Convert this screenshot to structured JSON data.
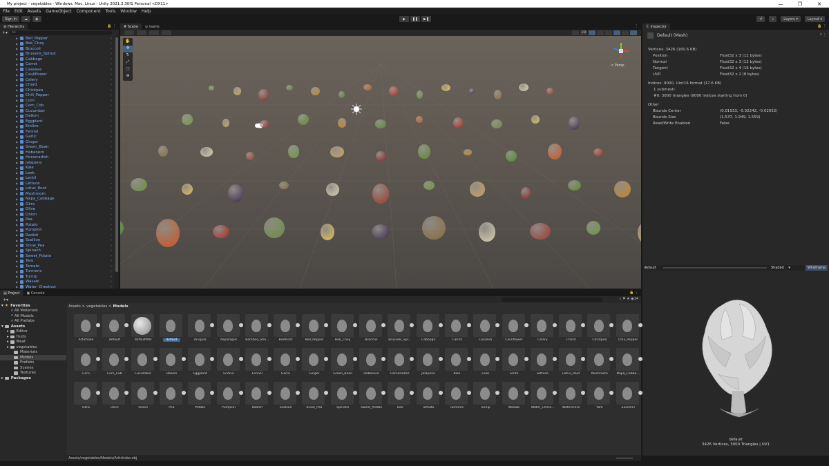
{
  "window": {
    "title": "My project - vegetables - Windows, Mac, Linux - Unity 2021.3.30f1 Personal <DX11>",
    "minimize": "—",
    "restore": "❐",
    "close": "✕"
  },
  "menu": [
    "File",
    "Edit",
    "Assets",
    "GameObject",
    "Component",
    "Tools",
    "Window",
    "Help"
  ],
  "toolbar": {
    "sign_in": "Sign In",
    "layers": "Layers",
    "layout": "Layout"
  },
  "hierarchy": {
    "tab": "Hierarchy",
    "search_placeholder": "All",
    "items": [
      "Bell_Pepper",
      "Bok_Choy",
      "Broccoli",
      "Brussels_Sprout",
      "Cabbage",
      "Carrot",
      "Cassava",
      "Cauliflower",
      "Celery",
      "Chard",
      "Chickpea",
      "Chili_Pepper",
      "Corn",
      "Corn_Cob",
      "Cucumber",
      "Daikon",
      "Eggplant",
      "Endive",
      "Fennel",
      "Garlic",
      "Ginger",
      "Green_Bean",
      "Habanero",
      "Horseradish",
      "Jalapeno",
      "Kale",
      "Leek",
      "Lentil",
      "Lettuce",
      "Lotus_Root",
      "Mushroom",
      "Napa_Cabbage",
      "Okra",
      "Olive",
      "Onion",
      "Pea",
      "Potato",
      "Pumpkin",
      "Radish",
      "Scallion",
      "Snow_Pea",
      "Spinach",
      "Sweet_Potato",
      "Taro",
      "Tomato",
      "Turmeric",
      "Turnip",
      "Wasabi",
      "Water_Chestnut"
    ]
  },
  "scene": {
    "tab_scene": "Scene",
    "tab_game": "Game",
    "mode_2d": "2D",
    "persp": "< Persp"
  },
  "inspector": {
    "tab": "Inspector",
    "title": "Default (Mesh)",
    "vertices": "Vertices: 3426 (160.6 KB)",
    "attributes": [
      {
        "name": "Position",
        "value": "Float32 x 3 (12 bytes)"
      },
      {
        "name": "Normal",
        "value": "Float32 x 3 (12 bytes)"
      },
      {
        "name": "Tangent",
        "value": "Float32 x 4 (16 bytes)"
      },
      {
        "name": "UV0",
        "value": "Float32 x 2 (8 bytes)"
      }
    ],
    "indices": "Indices: 9000, Uint16 format (17.6 KB)",
    "submesh": "1 submesh:",
    "submesh0": "#0: 3000 triangles (9000 indices starting from 0)",
    "other_header": "Other",
    "other": [
      {
        "name": "Bounds Center",
        "value": "(0.01933, -0.02242, -0.02052)"
      },
      {
        "name": "Bounds Size",
        "value": "(1.537, 1.949, 1.559)"
      },
      {
        "name": "Read/Write Enabled",
        "value": "False"
      }
    ]
  },
  "preview": {
    "name": "default",
    "shaded": "Shaded",
    "wireframe": "Wireframe",
    "caption_name": "default",
    "caption_stats": "3426 Vertices, 3000 Triangles | UV1"
  },
  "project": {
    "tab_project": "Project",
    "tab_console": "Console",
    "count": "14",
    "breadcrumb": {
      "a": "Assets",
      "b": "vegetables",
      "c": "Models"
    },
    "tree": {
      "favorites": "Favorites",
      "fav_items": [
        "All Materials",
        "All Models",
        "All Prefabs"
      ],
      "assets": "Assets",
      "asset_items": [
        "Editor",
        "fruits",
        "Meat",
        "vegetables"
      ],
      "veg_items": [
        "Materials",
        "Models",
        "Prefabs",
        "Scenes",
        "Textures"
      ],
      "packages": "Packages"
    },
    "assets": [
      "Artichoke",
      "default",
      "defaultMat",
      "default",
      "Arugula",
      "Asparagus",
      "Bamboo_Sho...",
      "Beetroot",
      "Bell_Pepper",
      "Bok_Choy",
      "Broccoli",
      "Brussels_Spr...",
      "Cabbage",
      "Carrot",
      "Cassava",
      "Cauliflower",
      "Celery",
      "Chard",
      "Chickpea",
      "Chili_Pepper",
      "Corn",
      "Corn_Cob",
      "Cucumber",
      "Daikon",
      "Eggplant",
      "Endive",
      "Fennel",
      "Garlic",
      "Ginger",
      "Green_Bean",
      "Habanero",
      "Horseradish",
      "Jalapeno",
      "Kale",
      "Leek",
      "Lentil",
      "Lettuce",
      "Lotus_Root",
      "Mushroom",
      "Napa_Cabba...",
      "Okra",
      "Olive",
      "Onion",
      "Pea",
      "Potato",
      "Pumpkin",
      "Radish",
      "Scallion",
      "Snow_Pea",
      "Spinach",
      "Sweet_Potato",
      "Taro",
      "Tomato",
      "Turmeric",
      "Turnip",
      "Wasabi",
      "Water_Chest...",
      "Watercress",
      "Yam",
      "Zucchini"
    ],
    "selected_index": 3,
    "path": "Assets/vegetables/Models/Artichoke.obj"
  }
}
